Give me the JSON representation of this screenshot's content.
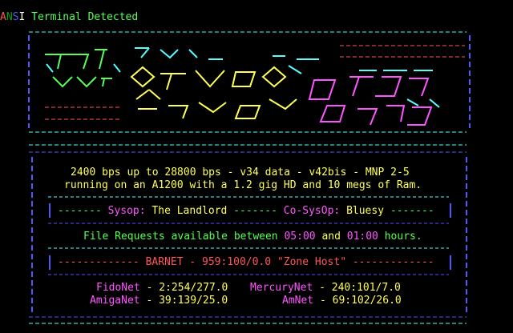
{
  "title": {
    "a": "A",
    "n": "N",
    "s": "S",
    "i": "I",
    "rest": " Terminal Detected"
  },
  "logo_art": {
    "cyan": [
      " ___  _  __  _    __  _  ____",
      "\\_ _//_/ / / /|  / // /  \\_ /",
      " / / / /  \\ \\/ | / // / _  //",
      "/_/  \\_/  /_/  |/_//_/ /___/"
    ],
    "yellow": [
      "  ___  __  ___   __",
      " / __// / / _ \\  / /",
      "/ /_ / /_/ // / / /",
      "\\__/ \\__/ \\___/ /_/"
    ],
    "magenta": [
      " ___  __ __  ___",
      "/ _ \\/ // / / _ \\",
      "/ __// _  / / __/",
      "\\___//_//_/ \\___/"
    ]
  },
  "info": {
    "line1": "2400 bps up to 28800 bps - v34 data - v42bis - MNP 2-5",
    "line2": "running on an A1200 with a 1.2 gig HD and 10 megs of Ram.",
    "sysop_dash_left": "-------",
    "sysop_label": "Sysop:",
    "sysop_name": "The Landlord",
    "sysop_dash_mid": "-------",
    "cosysop_label": "Co-SysOp:",
    "cosysop_name": "Bluesy",
    "sysop_dash_right": "-------",
    "freq_a": "File Requests available between",
    "freq_t1": "05:00",
    "freq_and": "and",
    "freq_t2": "01:00",
    "freq_b": "hours.",
    "barnet_left": "-------------",
    "barnet_text": "BARNET - 959:100/0.0 \"Zone Host\"",
    "barnet_right": "-------------",
    "nets": [
      {
        "name": "FidoNet",
        "addr": "2:254/277.0"
      },
      {
        "name": "MercuryNet",
        "addr": "240:101/7.0"
      },
      {
        "name": "AmigaNet",
        "addr": "39:139/25.0"
      },
      {
        "name": "AmNet",
        "addr": "69:102/26.0"
      }
    ]
  },
  "colors": {
    "cyan": "#55ffff",
    "blue": "#5555ff",
    "green": "#55ff55",
    "yellow": "#ffff55",
    "magenta": "#ff55ff",
    "red": "#ff5555"
  }
}
